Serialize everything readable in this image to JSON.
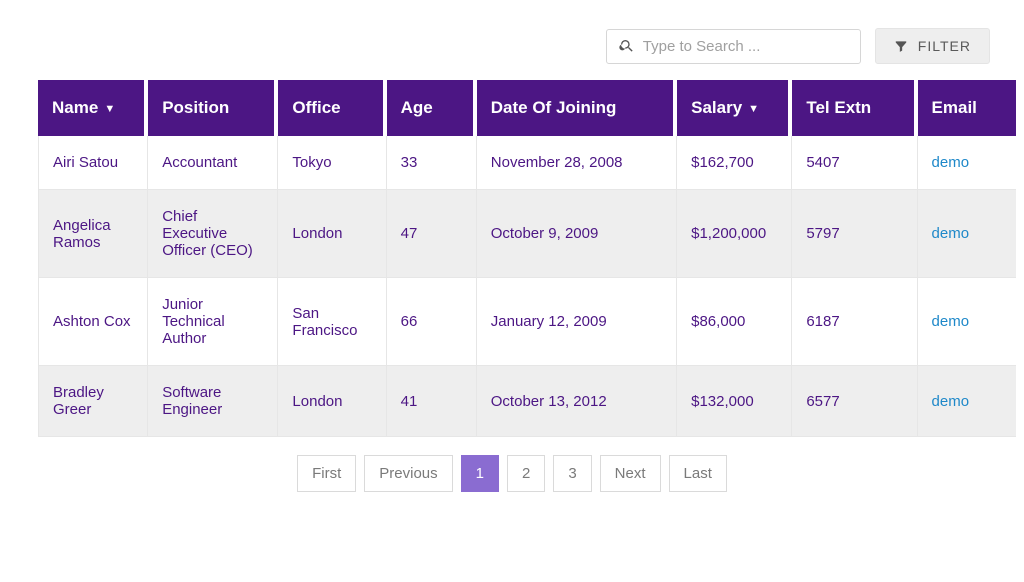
{
  "toolbar": {
    "search_placeholder": "Type to Search ...",
    "filter_label": "FILTER"
  },
  "table": {
    "headers": {
      "name": "Name",
      "position": "Position",
      "office": "Office",
      "age": "Age",
      "doj": "Date Of Joining",
      "salary": "Salary",
      "tel": "Tel Extn",
      "email": "Email"
    },
    "rows": [
      {
        "name": "Airi Satou",
        "position": "Accountant",
        "office": "Tokyo",
        "age": "33",
        "doj": "November 28, 2008",
        "salary": "$162,700",
        "tel": "5407",
        "email": "demo"
      },
      {
        "name": "Angelica Ramos",
        "position": "Chief Executive Officer (CEO)",
        "office": "London",
        "age": "47",
        "doj": "October 9, 2009",
        "salary": "$1,200,000",
        "tel": "5797",
        "email": "demo"
      },
      {
        "name": "Ashton Cox",
        "position": "Junior Technical Author",
        "office": "San Francisco",
        "age": "66",
        "doj": "January 12, 2009",
        "salary": "$86,000",
        "tel": "6187",
        "email": "demo"
      },
      {
        "name": "Bradley Greer",
        "position": "Software Engineer",
        "office": "London",
        "age": "41",
        "doj": "October 13, 2012",
        "salary": "$132,000",
        "tel": "6577",
        "email": "demo"
      }
    ]
  },
  "pagination": {
    "first": "First",
    "prev": "Previous",
    "pages": [
      "1",
      "2",
      "3"
    ],
    "active_index": 0,
    "next": "Next",
    "last": "Last"
  }
}
